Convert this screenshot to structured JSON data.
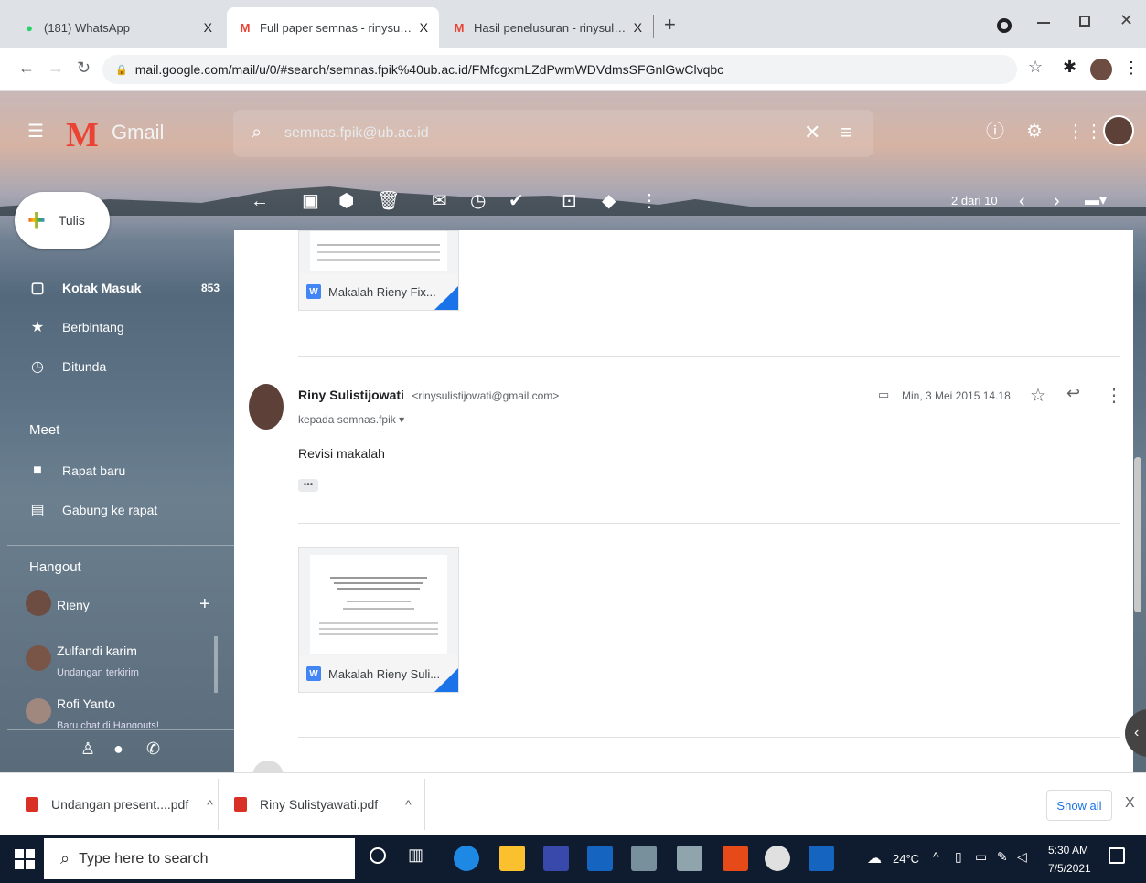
{
  "browser": {
    "tabs": [
      {
        "title": "(181) WhatsApp",
        "close": "X"
      },
      {
        "title": "Full paper semnas - rinysulistijo",
        "close": "X"
      },
      {
        "title": "Hasil penelusuran - rinysulistijo",
        "close": "X"
      }
    ],
    "new_tab": "+",
    "url": "mail.google.com/mail/u/0/#search/semnas.fpik%40ub.ac.id/FMfcgxmLZdPwmWDVdmsSFGnlGwClvqbc"
  },
  "gmail": {
    "logo_text": "Gmail",
    "search_value": "semnas.fpik@ub.ac.id",
    "pager": "2 dari 10",
    "compose_label": "Tulis",
    "nav": [
      {
        "label": "Kotak Masuk",
        "count": "853"
      },
      {
        "label": "Berbintang",
        "count": ""
      },
      {
        "label": "Ditunda",
        "count": ""
      }
    ],
    "meet": {
      "title": "Meet",
      "items": [
        "Rapat baru",
        "Gabung ke rapat"
      ]
    },
    "hangout": {
      "title": "Hangout",
      "self_name": "Rieny",
      "contacts": [
        {
          "name": "Zulfandi karim",
          "status": "Undangan terkirim"
        },
        {
          "name": "Rofi Yanto",
          "status": "Baru chat di Hangouts!"
        }
      ]
    },
    "attachments": [
      {
        "name": "Makalah Rieny Fix..."
      },
      {
        "name": "Makalah Rieny Suli..."
      }
    ],
    "message": {
      "sender": "Riny Sulistijowati",
      "email": "<rinysulistijowati@gmail.com>",
      "to": "kepada semnas.fpik",
      "date": "Min, 3 Mei 2015 14.18",
      "body": "Revisi makalah",
      "more": "•••"
    }
  },
  "downloads": {
    "items": [
      "Undangan present....pdf",
      "Riny Sulistyawati.pdf"
    ],
    "show_all": "Show all",
    "close": "X"
  },
  "taskbar": {
    "search_placeholder": "Type here to search",
    "weather": "24°C",
    "time": "5:30 AM",
    "date": "7/5/2021"
  },
  "colors": {
    "gmail_red": "#ea4335",
    "link_blue": "#1a73e8",
    "word_blue": "#4285f4",
    "taskbar": "#0f1b2e"
  }
}
